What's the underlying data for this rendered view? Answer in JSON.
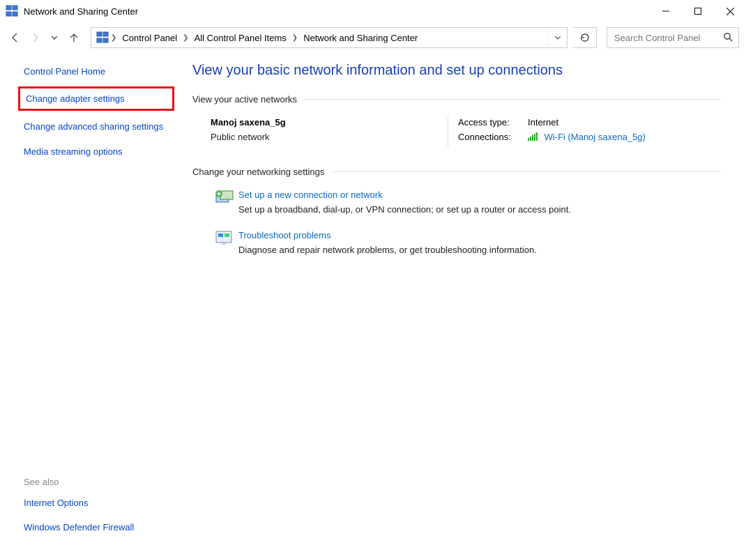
{
  "window": {
    "title": "Network and Sharing Center"
  },
  "breadcrumb": {
    "items": [
      "Control Panel",
      "All Control Panel Items",
      "Network and Sharing Center"
    ]
  },
  "search": {
    "placeholder": "Search Control Panel"
  },
  "sidebar": {
    "home": "Control Panel Home",
    "links": {
      "change_adapter": "Change adapter settings",
      "change_advanced": "Change advanced sharing settings",
      "media_streaming": "Media streaming options"
    },
    "see_also_label": "See also",
    "see_also": {
      "internet_options": "Internet Options",
      "firewall": "Windows Defender Firewall"
    }
  },
  "main": {
    "page_title": "View your basic network information and set up connections",
    "active_networks_header": "View your active networks",
    "network": {
      "name": "Manoj saxena_5g",
      "type": "Public network",
      "access_label": "Access type:",
      "access_value": "Internet",
      "connections_label": "Connections:",
      "connection_link": "Wi-Fi (Manoj saxena_5g)"
    },
    "change_settings_header": "Change your networking settings",
    "tasks": {
      "setup": {
        "title": "Set up a new connection or network",
        "desc": "Set up a broadband, dial-up, or VPN connection; or set up a router or access point."
      },
      "troubleshoot": {
        "title": "Troubleshoot problems",
        "desc": "Diagnose and repair network problems, or get troubleshooting information."
      }
    }
  }
}
